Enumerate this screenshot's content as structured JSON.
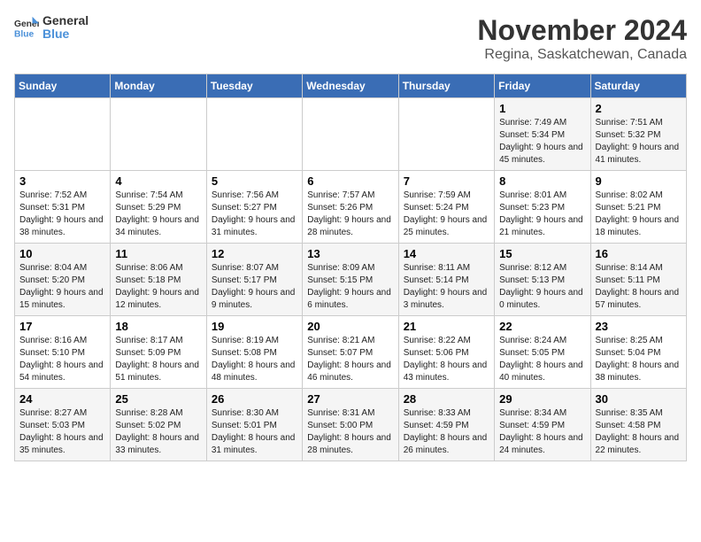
{
  "header": {
    "logo_text_general": "General",
    "logo_text_blue": "Blue",
    "month": "November 2024",
    "location": "Regina, Saskatchewan, Canada"
  },
  "weekdays": [
    "Sunday",
    "Monday",
    "Tuesday",
    "Wednesday",
    "Thursday",
    "Friday",
    "Saturday"
  ],
  "weeks": [
    [
      {
        "day": "",
        "info": ""
      },
      {
        "day": "",
        "info": ""
      },
      {
        "day": "",
        "info": ""
      },
      {
        "day": "",
        "info": ""
      },
      {
        "day": "",
        "info": ""
      },
      {
        "day": "1",
        "info": "Sunrise: 7:49 AM\nSunset: 5:34 PM\nDaylight: 9 hours and 45 minutes."
      },
      {
        "day": "2",
        "info": "Sunrise: 7:51 AM\nSunset: 5:32 PM\nDaylight: 9 hours and 41 minutes."
      }
    ],
    [
      {
        "day": "3",
        "info": "Sunrise: 7:52 AM\nSunset: 5:31 PM\nDaylight: 9 hours and 38 minutes."
      },
      {
        "day": "4",
        "info": "Sunrise: 7:54 AM\nSunset: 5:29 PM\nDaylight: 9 hours and 34 minutes."
      },
      {
        "day": "5",
        "info": "Sunrise: 7:56 AM\nSunset: 5:27 PM\nDaylight: 9 hours and 31 minutes."
      },
      {
        "day": "6",
        "info": "Sunrise: 7:57 AM\nSunset: 5:26 PM\nDaylight: 9 hours and 28 minutes."
      },
      {
        "day": "7",
        "info": "Sunrise: 7:59 AM\nSunset: 5:24 PM\nDaylight: 9 hours and 25 minutes."
      },
      {
        "day": "8",
        "info": "Sunrise: 8:01 AM\nSunset: 5:23 PM\nDaylight: 9 hours and 21 minutes."
      },
      {
        "day": "9",
        "info": "Sunrise: 8:02 AM\nSunset: 5:21 PM\nDaylight: 9 hours and 18 minutes."
      }
    ],
    [
      {
        "day": "10",
        "info": "Sunrise: 8:04 AM\nSunset: 5:20 PM\nDaylight: 9 hours and 15 minutes."
      },
      {
        "day": "11",
        "info": "Sunrise: 8:06 AM\nSunset: 5:18 PM\nDaylight: 9 hours and 12 minutes."
      },
      {
        "day": "12",
        "info": "Sunrise: 8:07 AM\nSunset: 5:17 PM\nDaylight: 9 hours and 9 minutes."
      },
      {
        "day": "13",
        "info": "Sunrise: 8:09 AM\nSunset: 5:15 PM\nDaylight: 9 hours and 6 minutes."
      },
      {
        "day": "14",
        "info": "Sunrise: 8:11 AM\nSunset: 5:14 PM\nDaylight: 9 hours and 3 minutes."
      },
      {
        "day": "15",
        "info": "Sunrise: 8:12 AM\nSunset: 5:13 PM\nDaylight: 9 hours and 0 minutes."
      },
      {
        "day": "16",
        "info": "Sunrise: 8:14 AM\nSunset: 5:11 PM\nDaylight: 8 hours and 57 minutes."
      }
    ],
    [
      {
        "day": "17",
        "info": "Sunrise: 8:16 AM\nSunset: 5:10 PM\nDaylight: 8 hours and 54 minutes."
      },
      {
        "day": "18",
        "info": "Sunrise: 8:17 AM\nSunset: 5:09 PM\nDaylight: 8 hours and 51 minutes."
      },
      {
        "day": "19",
        "info": "Sunrise: 8:19 AM\nSunset: 5:08 PM\nDaylight: 8 hours and 48 minutes."
      },
      {
        "day": "20",
        "info": "Sunrise: 8:21 AM\nSunset: 5:07 PM\nDaylight: 8 hours and 46 minutes."
      },
      {
        "day": "21",
        "info": "Sunrise: 8:22 AM\nSunset: 5:06 PM\nDaylight: 8 hours and 43 minutes."
      },
      {
        "day": "22",
        "info": "Sunrise: 8:24 AM\nSunset: 5:05 PM\nDaylight: 8 hours and 40 minutes."
      },
      {
        "day": "23",
        "info": "Sunrise: 8:25 AM\nSunset: 5:04 PM\nDaylight: 8 hours and 38 minutes."
      }
    ],
    [
      {
        "day": "24",
        "info": "Sunrise: 8:27 AM\nSunset: 5:03 PM\nDaylight: 8 hours and 35 minutes."
      },
      {
        "day": "25",
        "info": "Sunrise: 8:28 AM\nSunset: 5:02 PM\nDaylight: 8 hours and 33 minutes."
      },
      {
        "day": "26",
        "info": "Sunrise: 8:30 AM\nSunset: 5:01 PM\nDaylight: 8 hours and 31 minutes."
      },
      {
        "day": "27",
        "info": "Sunrise: 8:31 AM\nSunset: 5:00 PM\nDaylight: 8 hours and 28 minutes."
      },
      {
        "day": "28",
        "info": "Sunrise: 8:33 AM\nSunset: 4:59 PM\nDaylight: 8 hours and 26 minutes."
      },
      {
        "day": "29",
        "info": "Sunrise: 8:34 AM\nSunset: 4:59 PM\nDaylight: 8 hours and 24 minutes."
      },
      {
        "day": "30",
        "info": "Sunrise: 8:35 AM\nSunset: 4:58 PM\nDaylight: 8 hours and 22 minutes."
      }
    ]
  ]
}
